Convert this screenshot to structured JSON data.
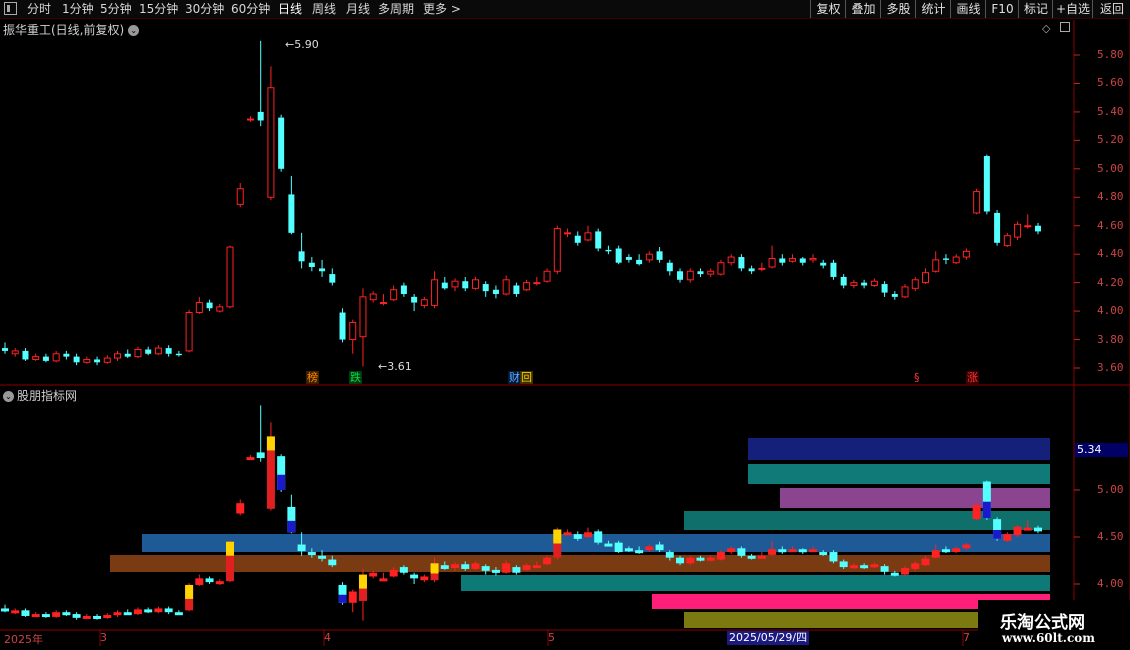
{
  "toolbar": {
    "tabs": [
      "分时",
      "1分钟",
      "5分钟",
      "15分钟",
      "30分钟",
      "60分钟",
      "日线",
      "周线",
      "月线",
      "多周期",
      "更多 >"
    ],
    "active_tab": "日线",
    "right_buttons": [
      "复权",
      "叠加",
      "多股",
      "统计",
      "画线",
      "F10",
      "+自选",
      "标记",
      "返回"
    ]
  },
  "main_panel": {
    "title": "振华重工(日线,前复权)",
    "price_axis": [
      "5.80",
      "5.60",
      "5.40",
      "5.20",
      "5.00",
      "4.80",
      "4.60",
      "4.40",
      "4.20",
      "4.00",
      "3.80",
      "3.60"
    ],
    "high_label": "5.90",
    "low_label": "3.61",
    "markers": [
      {
        "text": "榜",
        "color": "#ff8800",
        "bg": "#3a2000"
      },
      {
        "text": "跌",
        "color": "#00dd44",
        "bg": "#003a10"
      },
      {
        "text": "财",
        "color": "#66aaff",
        "bg": "#001a3a"
      },
      {
        "text": "回",
        "color": "#ffcc00",
        "bg": "#3a3000"
      },
      {
        "text": "§",
        "color": "#ff3333",
        "bg": "#000000"
      },
      {
        "text": "涨",
        "color": "#ff3333",
        "bg": "#3a0000"
      }
    ]
  },
  "sub_panel": {
    "title": "股朋指标网",
    "axis": [
      "5.00",
      "4.50",
      "4.00"
    ],
    "current_value": "5.34"
  },
  "date_axis": {
    "labels": [
      "2025年",
      "3",
      "4",
      "5",
      "7"
    ],
    "cursor_date": "2025/05/29/四"
  },
  "watermark": {
    "title": "乐淘公式网",
    "url": "www.60lt.com"
  },
  "colors": {
    "up": "#ff2222",
    "down": "#54ffff",
    "axis": "#cc2222",
    "band_colors": [
      "#14207a",
      "#0f7a78",
      "#8a4490",
      "#0f6f6b",
      "#1e5a96",
      "#7a3a12",
      "#0d7a78",
      "#ff1f7a",
      "#7a7a10"
    ]
  },
  "chart_data": {
    "type": "candlestick",
    "ylim": [
      3.55,
      5.95
    ],
    "candles": [
      [
        3.74,
        3.72,
        3.78,
        3.7
      ],
      [
        3.7,
        3.72,
        3.74,
        3.68
      ],
      [
        3.72,
        3.66,
        3.74,
        3.65
      ],
      [
        3.66,
        3.68,
        3.7,
        3.65
      ],
      [
        3.68,
        3.65,
        3.7,
        3.64
      ],
      [
        3.65,
        3.7,
        3.72,
        3.64
      ],
      [
        3.7,
        3.68,
        3.72,
        3.66
      ],
      [
        3.68,
        3.64,
        3.7,
        3.62
      ],
      [
        3.64,
        3.66,
        3.68,
        3.63
      ],
      [
        3.66,
        3.64,
        3.68,
        3.62
      ],
      [
        3.64,
        3.67,
        3.69,
        3.63
      ],
      [
        3.67,
        3.7,
        3.72,
        3.65
      ],
      [
        3.7,
        3.68,
        3.73,
        3.67
      ],
      [
        3.68,
        3.73,
        3.75,
        3.67
      ],
      [
        3.73,
        3.7,
        3.75,
        3.69
      ],
      [
        3.7,
        3.74,
        3.76,
        3.69
      ],
      [
        3.74,
        3.7,
        3.76,
        3.68
      ],
      [
        3.7,
        3.69,
        3.72,
        3.68
      ],
      [
        3.72,
        3.99,
        4.01,
        3.71
      ],
      [
        3.99,
        4.06,
        4.1,
        3.98
      ],
      [
        4.06,
        4.02,
        4.08,
        4.0
      ],
      [
        4.0,
        4.03,
        4.05,
        3.99
      ],
      [
        4.03,
        4.45,
        4.46,
        4.02
      ],
      [
        4.75,
        4.86,
        4.9,
        4.73
      ],
      [
        5.35,
        5.35,
        5.37,
        5.33
      ],
      [
        5.4,
        5.34,
        5.9,
        5.3
      ],
      [
        4.8,
        5.57,
        5.72,
        4.78
      ],
      [
        5.36,
        5.0,
        5.38,
        4.98
      ],
      [
        4.82,
        4.55,
        4.95,
        4.54
      ],
      [
        4.42,
        4.35,
        4.55,
        4.3
      ],
      [
        4.34,
        4.31,
        4.38,
        4.28
      ],
      [
        4.3,
        4.28,
        4.36,
        4.24
      ],
      [
        4.26,
        4.2,
        4.3,
        4.18
      ],
      [
        3.99,
        3.8,
        4.02,
        3.78
      ],
      [
        3.8,
        3.92,
        3.94,
        3.7
      ],
      [
        3.82,
        4.1,
        4.16,
        3.61
      ],
      [
        4.08,
        4.12,
        4.14,
        4.06
      ],
      [
        4.06,
        4.06,
        4.12,
        4.04
      ],
      [
        4.08,
        4.15,
        4.18,
        4.07
      ],
      [
        4.18,
        4.12,
        4.2,
        4.1
      ],
      [
        4.1,
        4.06,
        4.12,
        4.0
      ],
      [
        4.04,
        4.08,
        4.1,
        4.02
      ],
      [
        4.04,
        4.22,
        4.28,
        4.02
      ],
      [
        4.2,
        4.16,
        4.24,
        4.15
      ],
      [
        4.17,
        4.21,
        4.23,
        4.14
      ],
      [
        4.21,
        4.16,
        4.24,
        4.14
      ],
      [
        4.16,
        4.22,
        4.24,
        4.15
      ],
      [
        4.19,
        4.14,
        4.21,
        4.1
      ],
      [
        4.15,
        4.12,
        4.18,
        4.09
      ],
      [
        4.12,
        4.22,
        4.25,
        4.11
      ],
      [
        4.18,
        4.12,
        4.2,
        4.1
      ],
      [
        4.15,
        4.2,
        4.22,
        4.14
      ],
      [
        4.2,
        4.2,
        4.24,
        4.18
      ],
      [
        4.21,
        4.28,
        4.3,
        4.2
      ],
      [
        4.28,
        4.58,
        4.6,
        4.26
      ],
      [
        4.55,
        4.55,
        4.58,
        4.52
      ],
      [
        4.53,
        4.48,
        4.56,
        4.46
      ],
      [
        4.5,
        4.55,
        4.6,
        4.49
      ],
      [
        4.56,
        4.44,
        4.58,
        4.42
      ],
      [
        4.43,
        4.42,
        4.46,
        4.4
      ],
      [
        4.44,
        4.34,
        4.46,
        4.33
      ],
      [
        4.38,
        4.36,
        4.4,
        4.34
      ],
      [
        4.36,
        4.33,
        4.4,
        4.32
      ],
      [
        4.36,
        4.4,
        4.42,
        4.34
      ],
      [
        4.42,
        4.36,
        4.45,
        4.34
      ],
      [
        4.34,
        4.28,
        4.36,
        4.25
      ],
      [
        4.28,
        4.22,
        4.3,
        4.2
      ],
      [
        4.22,
        4.28,
        4.3,
        4.2
      ],
      [
        4.28,
        4.26,
        4.3,
        4.24
      ],
      [
        4.26,
        4.28,
        4.3,
        4.24
      ],
      [
        4.26,
        4.34,
        4.36,
        4.25
      ],
      [
        4.34,
        4.38,
        4.4,
        4.32
      ],
      [
        4.38,
        4.3,
        4.4,
        4.28
      ],
      [
        4.3,
        4.28,
        4.32,
        4.26
      ],
      [
        4.3,
        4.3,
        4.34,
        4.28
      ],
      [
        4.31,
        4.37,
        4.46,
        4.3
      ],
      [
        4.37,
        4.34,
        4.4,
        4.32
      ],
      [
        4.35,
        4.37,
        4.4,
        4.34
      ],
      [
        4.37,
        4.34,
        4.38,
        4.32
      ],
      [
        4.36,
        4.37,
        4.4,
        4.34
      ],
      [
        4.34,
        4.32,
        4.36,
        4.3
      ],
      [
        4.34,
        4.24,
        4.36,
        4.22
      ],
      [
        4.24,
        4.18,
        4.26,
        4.16
      ],
      [
        4.18,
        4.2,
        4.22,
        4.16
      ],
      [
        4.2,
        4.18,
        4.22,
        4.16
      ],
      [
        4.18,
        4.21,
        4.23,
        4.17
      ],
      [
        4.19,
        4.13,
        4.21,
        4.1
      ],
      [
        4.12,
        4.1,
        4.14,
        4.08
      ],
      [
        4.1,
        4.17,
        4.19,
        4.09
      ],
      [
        4.16,
        4.22,
        4.24,
        4.14
      ],
      [
        4.2,
        4.27,
        4.3,
        4.19
      ],
      [
        4.28,
        4.36,
        4.42,
        4.27
      ],
      [
        4.37,
        4.36,
        4.4,
        4.33
      ],
      [
        4.34,
        4.38,
        4.4,
        4.33
      ],
      [
        4.38,
        4.42,
        4.44,
        4.36
      ],
      [
        4.69,
        4.84,
        4.86,
        4.68
      ],
      [
        5.09,
        4.7,
        5.1,
        4.68
      ],
      [
        4.69,
        4.48,
        4.71,
        4.46
      ],
      [
        4.46,
        4.53,
        4.55,
        4.45
      ],
      [
        4.52,
        4.61,
        4.63,
        4.5
      ],
      [
        4.6,
        4.6,
        4.68,
        4.58
      ],
      [
        4.6,
        4.56,
        4.62,
        4.54
      ]
    ]
  },
  "bands": [
    {
      "x1": 748,
      "x2": 1050,
      "y1": 438,
      "y2": 460,
      "c": 0
    },
    {
      "x1": 748,
      "x2": 1050,
      "y1": 464,
      "y2": 484,
      "c": 1
    },
    {
      "x1": 780,
      "x2": 1050,
      "y1": 488,
      "y2": 508,
      "c": 2
    },
    {
      "x1": 684,
      "x2": 1050,
      "y1": 511,
      "y2": 530,
      "c": 3
    },
    {
      "x1": 142,
      "x2": 1050,
      "y1": 534,
      "y2": 552,
      "c": 4
    },
    {
      "x1": 110,
      "x2": 1050,
      "y1": 555,
      "y2": 572,
      "c": 5
    },
    {
      "x1": 461,
      "x2": 1050,
      "y1": 575,
      "y2": 591,
      "c": 6
    },
    {
      "x1": 652,
      "x2": 1050,
      "y1": 594,
      "y2": 609,
      "c": 7
    },
    {
      "x1": 684,
      "x2": 1050,
      "y1": 612,
      "y2": 628,
      "c": 8
    }
  ]
}
